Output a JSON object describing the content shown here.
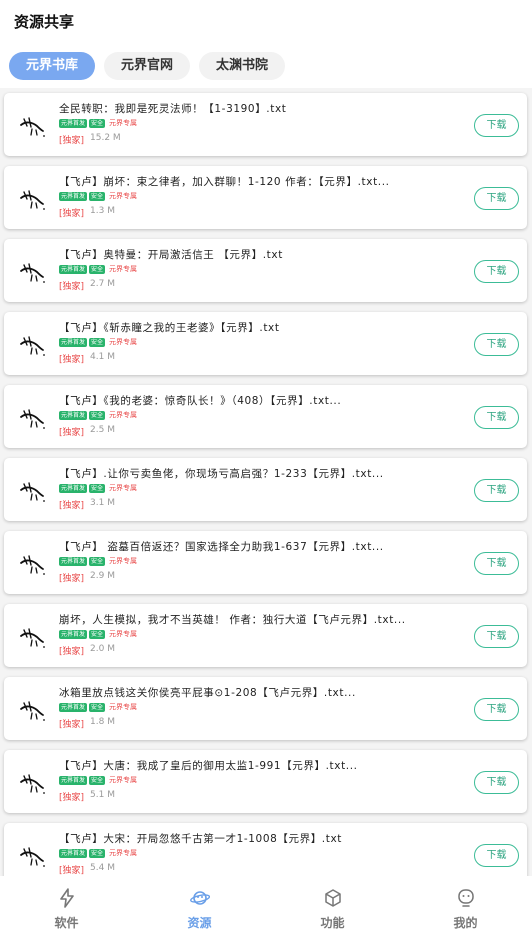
{
  "header": {
    "title": "资源共享"
  },
  "tabs": [
    {
      "label": "元界书库",
      "active": true
    },
    {
      "label": "元界官网",
      "active": false
    },
    {
      "label": "太渊书院",
      "active": false
    }
  ],
  "badges": {
    "tag1": "元界首发",
    "tag2": "安全",
    "tag3": "元界专属"
  },
  "download_label": "下载",
  "items": [
    {
      "title": "全民转职：我即是死灵法师！【1-3190】.txt",
      "tag": "[独家]",
      "size": "15.2 M"
    },
    {
      "title": "【飞卢】崩坏：束之律者，加入群聊！1-120 作者：【元界】.txt...",
      "tag": "[独家]",
      "size": "1.3 M"
    },
    {
      "title": "【飞卢】奥特曼：开局激活信王 【元界】.txt",
      "tag": "[独家]",
      "size": "2.7 M"
    },
    {
      "title": "【飞卢】《斩赤瞳之我的王老婆》【元界】.txt",
      "tag": "[独家]",
      "size": "4.1 M"
    },
    {
      "title": "【飞卢】《我的老婆：惊奇队长！》（408）【元界】.txt...",
      "tag": "[独家]",
      "size": "2.5 M"
    },
    {
      "title": "【飞卢】.让你亏卖鱼佬，你现场亏高启强？1-233【元界】.txt...",
      "tag": "[独家]",
      "size": "3.1 M"
    },
    {
      "title": "【飞卢】 盗墓百倍返还？国家选择全力助我1-637【元界】.txt...",
      "tag": "[独家]",
      "size": "2.9 M"
    },
    {
      "title": "崩坏，人生模拟，我才不当英雄！ 作者：独行大道【飞卢元界】.txt...",
      "tag": "[独家]",
      "size": "2.0 M"
    },
    {
      "title": "冰箱里放点钱这关你侯亮平屁事⊙1-208【飞卢元界】.txt...",
      "tag": "[独家]",
      "size": "1.8 M"
    },
    {
      "title": "【飞卢】大唐：我成了皇后的御用太监1-991【元界】.txt...",
      "tag": "[独家]",
      "size": "5.1 M"
    },
    {
      "title": "【飞卢】大宋：开局忽悠千古第一才1-1008【元界】.txt",
      "tag": "[独家]",
      "size": "5.4 M"
    }
  ],
  "nav": [
    {
      "label": "软件",
      "icon": "lightning-icon",
      "active": false
    },
    {
      "label": "资源",
      "icon": "planet-icon",
      "active": true
    },
    {
      "label": "功能",
      "icon": "cube-icon",
      "active": false
    },
    {
      "label": "我的",
      "icon": "face-icon",
      "active": false
    }
  ],
  "colors": {
    "accent": "#7aa8f0",
    "download": "#3cbc97",
    "exclusive": "#e84848",
    "badge_green": "#29b36b"
  }
}
